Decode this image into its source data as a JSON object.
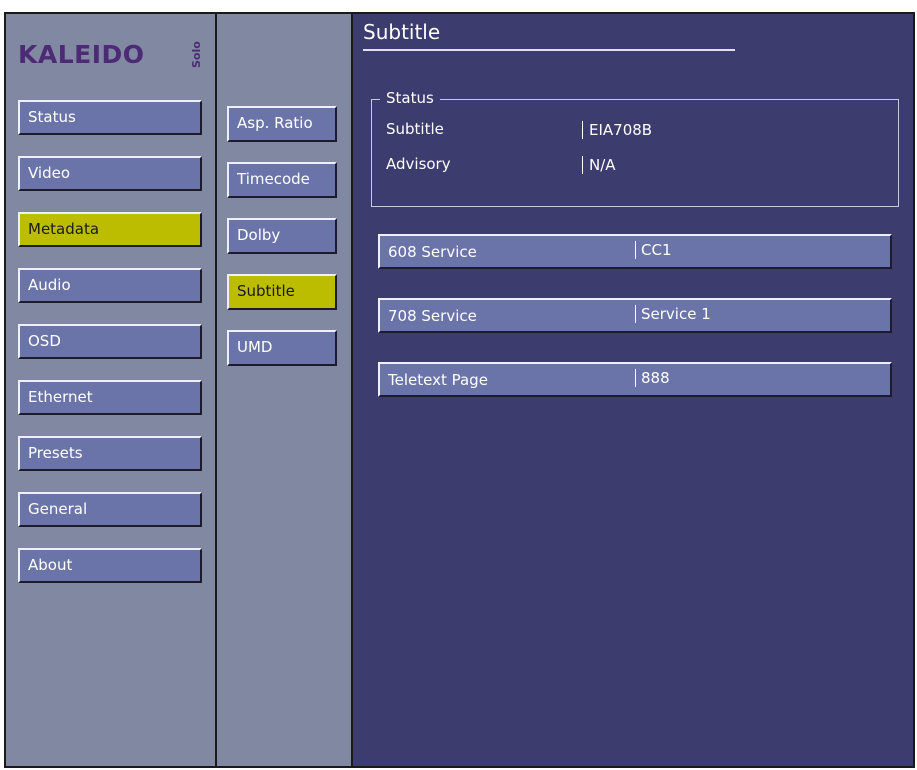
{
  "logo": {
    "brand": "KALEIDO",
    "edition": "Solo"
  },
  "main_nav": [
    {
      "label": "Status",
      "active": false
    },
    {
      "label": "Video",
      "active": false
    },
    {
      "label": "Metadata",
      "active": true
    },
    {
      "label": "Audio",
      "active": false
    },
    {
      "label": "OSD",
      "active": false
    },
    {
      "label": "Ethernet",
      "active": false
    },
    {
      "label": "Presets",
      "active": false
    },
    {
      "label": "General",
      "active": false
    },
    {
      "label": "About",
      "active": false
    }
  ],
  "sub_nav": [
    {
      "label": "Asp. Ratio",
      "active": false
    },
    {
      "label": "Timecode",
      "active": false
    },
    {
      "label": "Dolby",
      "active": false
    },
    {
      "label": "Subtitle",
      "active": true
    },
    {
      "label": "UMD",
      "active": false
    }
  ],
  "panel": {
    "title": "Subtitle",
    "status": {
      "legend": "Status",
      "rows": [
        {
          "label": "Subtitle",
          "value": "EIA708B"
        },
        {
          "label": "Advisory",
          "value": "N/A"
        }
      ]
    },
    "fields": [
      {
        "label": "608 Service",
        "value": "CC1"
      },
      {
        "label": "708 Service",
        "value": "Service 1"
      },
      {
        "label": "Teletext Page",
        "value": "888"
      }
    ]
  },
  "colors": {
    "background": "#3c3c6e",
    "nav_column": "#8088a2",
    "button": "#6a74a8",
    "active_button": "#bcbc00",
    "logo": "#4c2a74"
  }
}
